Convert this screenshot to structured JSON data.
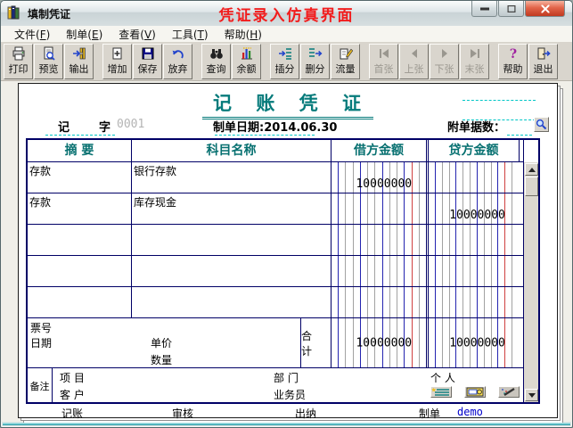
{
  "window": {
    "title": "填制凭证",
    "overlay_title": "凭证录入仿真界面",
    "controls": [
      "minimize",
      "maximize",
      "close"
    ]
  },
  "menu": {
    "items": [
      {
        "text": "文件",
        "hotkey": "F"
      },
      {
        "text": "制单",
        "hotkey": "E"
      },
      {
        "text": "查看",
        "hotkey": "V"
      },
      {
        "text": "工具",
        "hotkey": "T"
      },
      {
        "text": "帮助",
        "hotkey": "H"
      }
    ]
  },
  "toolbar": {
    "groups": [
      [
        {
          "label": "打印",
          "icon": "printer-icon",
          "enabled": true
        },
        {
          "label": "预览",
          "icon": "preview-icon",
          "enabled": true
        },
        {
          "label": "输出",
          "icon": "export-icon",
          "enabled": true
        }
      ],
      [
        {
          "label": "增加",
          "icon": "add-icon",
          "enabled": true
        },
        {
          "label": "保存",
          "icon": "save-icon",
          "enabled": true
        },
        {
          "label": "放弃",
          "icon": "undo-icon",
          "enabled": true
        }
      ],
      [
        {
          "label": "查询",
          "icon": "binoculars-icon",
          "enabled": true
        },
        {
          "label": "余额",
          "icon": "balance-chart-icon",
          "enabled": true
        }
      ],
      [
        {
          "label": "插分",
          "icon": "insert-split-icon",
          "enabled": true
        },
        {
          "label": "删分",
          "icon": "delete-split-icon",
          "enabled": true
        },
        {
          "label": "流量",
          "icon": "flow-icon",
          "enabled": true
        }
      ],
      [
        {
          "label": "首张",
          "icon": "first-icon",
          "enabled": false
        },
        {
          "label": "上张",
          "icon": "prev-icon",
          "enabled": false
        },
        {
          "label": "下张",
          "icon": "next-icon",
          "enabled": false
        },
        {
          "label": "末张",
          "icon": "last-icon",
          "enabled": false
        }
      ],
      [
        {
          "label": "帮助",
          "icon": "help-icon",
          "enabled": true
        },
        {
          "label": "退出",
          "icon": "exit-icon",
          "enabled": true
        }
      ]
    ]
  },
  "voucher": {
    "title": "记 账 凭 证",
    "word_left": "记",
    "word_right": "字",
    "voucher_no": "0001",
    "date_line": "制单日期:2014.06.30",
    "attach_label": "附单据数：",
    "table": {
      "headers": {
        "summary": "摘  要",
        "account": "科目名称",
        "debit": "借方金额",
        "credit": "贷方金额"
      },
      "rows": [
        {
          "summary": "存款",
          "account": "银行存款",
          "debit": "10000000",
          "credit": ""
        },
        {
          "summary": "存款",
          "account": "库存现金",
          "debit": "",
          "credit": "10000000"
        },
        {
          "summary": "",
          "account": "",
          "debit": "",
          "credit": ""
        },
        {
          "summary": "",
          "account": "",
          "debit": "",
          "credit": ""
        },
        {
          "summary": "",
          "account": "",
          "debit": "",
          "credit": ""
        }
      ],
      "totals": {
        "bill_no_label": "票号",
        "date_label": "日期",
        "unit_price_label": "单价",
        "quantity_label": "数量",
        "total_label": "合 计",
        "debit_total": "10000000",
        "credit_total": "10000000"
      }
    },
    "remarks": {
      "label": "备注",
      "project_label": "项  目",
      "customer_label": "客  户",
      "department_label": "部  门",
      "salesman_label": "业务员",
      "person_label": "个  人",
      "icons": [
        "note-icon",
        "mail-icon",
        "wand-icon"
      ]
    },
    "signatures": {
      "bookkeeper_label": "记账",
      "auditor_label": "审核",
      "cashier_label": "出纳",
      "preparer_label": "制单",
      "preparer_name": "demo"
    }
  },
  "colors": {
    "accent_teal": "#067b7b",
    "table_border": "#000066",
    "ledger_gray": "#a2a2a2",
    "ledger_blue": "#2424b0",
    "ledger_red": "#d04040",
    "overlay_red": "#f21d1d",
    "dashed_cyan": "#00c6c6",
    "preparer_blue": "#0000cc"
  }
}
